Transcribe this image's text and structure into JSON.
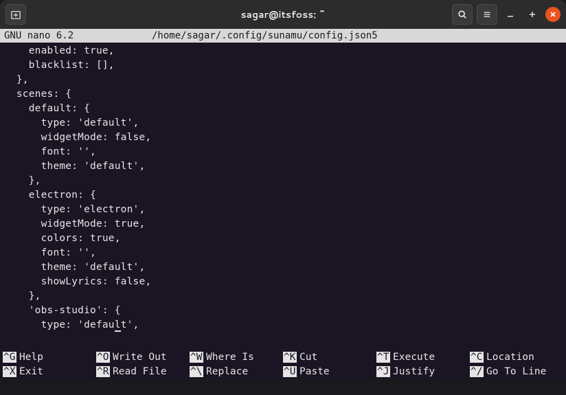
{
  "window": {
    "title": "sagar@itsfoss: ~"
  },
  "nano": {
    "version": " GNU nano 6.2",
    "filepath": "/home/sagar/.config/sunamu/config.json5"
  },
  "editor": {
    "lines": [
      "    enabled: true,",
      "    blacklist: [],",
      "  },",
      "  scenes: {",
      "    default: {",
      "      type: 'default',",
      "      widgetMode: false,",
      "      font: '',",
      "      theme: 'default',",
      "    },",
      "    electron: {",
      "      type: 'electron',",
      "      widgetMode: true,",
      "      colors: true,",
      "      font: '',",
      "      theme: 'default',",
      "      showLyrics: false,",
      "    },",
      "    'obs-studio': {",
      "      type: 'default',"
    ],
    "cursor_line": 19,
    "cursor_before": "      type: 'defau",
    "cursor_char": "l",
    "cursor_after": "t',"
  },
  "shortcuts": {
    "row1": [
      {
        "key": "^G",
        "label": "Help"
      },
      {
        "key": "^O",
        "label": "Write Out"
      },
      {
        "key": "^W",
        "label": "Where Is"
      },
      {
        "key": "^K",
        "label": "Cut"
      },
      {
        "key": "^T",
        "label": "Execute"
      },
      {
        "key": "^C",
        "label": "Location"
      }
    ],
    "row2": [
      {
        "key": "^X",
        "label": "Exit"
      },
      {
        "key": "^R",
        "label": "Read File"
      },
      {
        "key": "^\\",
        "label": "Replace"
      },
      {
        "key": "^U",
        "label": "Paste"
      },
      {
        "key": "^J",
        "label": "Justify"
      },
      {
        "key": "^/",
        "label": "Go To Line"
      }
    ]
  }
}
